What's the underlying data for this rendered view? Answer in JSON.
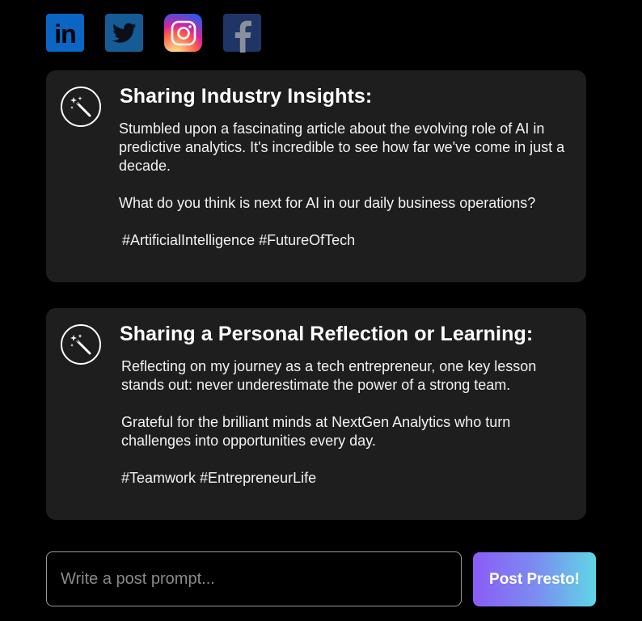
{
  "social": {
    "icons": [
      "linkedin-icon",
      "twitter-icon",
      "instagram-icon",
      "facebook-icon"
    ],
    "linkedin_label": "in"
  },
  "posts": [
    {
      "title": "Sharing Industry Insights:",
      "paragraphs": [
        "Stumbled upon a fascinating article about the evolving role of AI in predictive analytics. It's incredible to see how far we've come in just a decade.",
        "What do you think is next for AI in our daily business operations?"
      ],
      "tags": "#ArtificialIntelligence #FutureOfTech",
      "icon": "magic-wand-icon"
    },
    {
      "title": "Sharing a Personal Reflection or Learning:",
      "paragraphs": [
        "Reflecting on my journey as a tech entrepreneur, one key lesson stands out: never underestimate the power of a strong team.",
        "Grateful for the brilliant minds at NextGen Analytics who turn challenges into opportunities every day."
      ],
      "tags": "#Teamwork #EntrepreneurLife",
      "icon": "magic-wand-icon"
    }
  ],
  "composer": {
    "placeholder": "Write a post prompt...",
    "value": "",
    "button_label": "Post Presto!"
  },
  "colors": {
    "background": "#000000",
    "card": "#1e1e1e",
    "button_gradient_start": "#8b5cf6",
    "button_gradient_end": "#5fd6e6",
    "linkedin": "#0a66c2",
    "twitter": "#155c96",
    "facebook": "#1f3566"
  }
}
